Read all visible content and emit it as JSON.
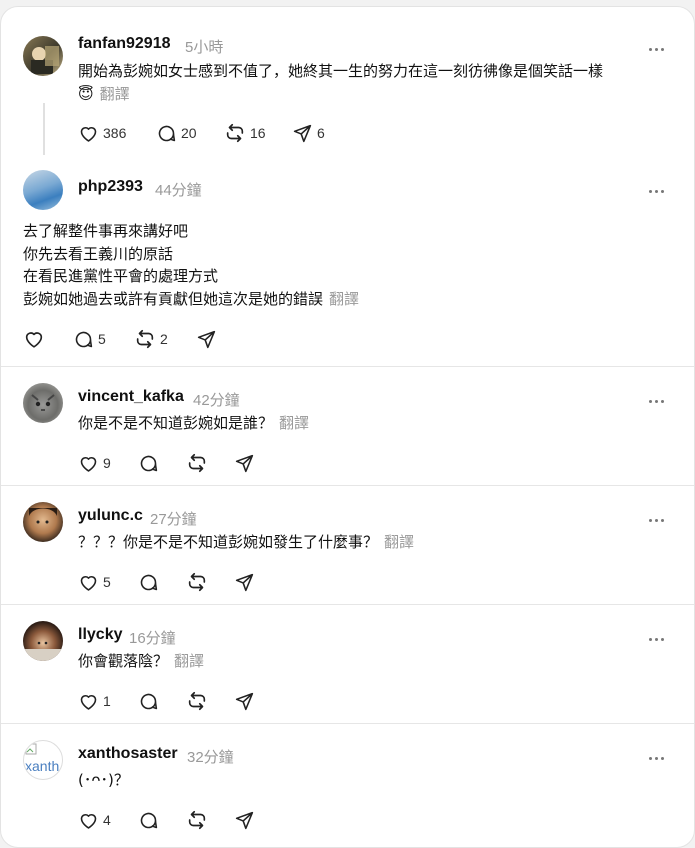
{
  "posts": [
    {
      "username": "fanfan92918",
      "time": "5小時",
      "lines": [
        "開始為彭婉如女士感到不值了，她終其一生的努力在這一刻彷彿像是個笑話一樣",
        "😇"
      ],
      "translate": "翻譯",
      "likes": "386",
      "comments": "20",
      "reposts": "16",
      "shares": "6"
    },
    {
      "username": "php2393",
      "time": "44分鐘",
      "lines": [
        "去了解整件事再來講好吧",
        "你先去看王義川的原話",
        "在看民進黨性平會的處理方式",
        "彭婉如她過去或許有貢獻但她這次是她的錯誤"
      ],
      "translate": "翻譯",
      "likes": "",
      "comments": "5",
      "reposts": "2",
      "shares": ""
    },
    {
      "username": "vincent_kafka",
      "time": "42分鐘",
      "lines": [
        "你是不是不知道彭婉如是誰？"
      ],
      "translate": "翻譯",
      "likes": "9",
      "comments": "",
      "reposts": "",
      "shares": ""
    },
    {
      "username": "yulunc.c",
      "time": "27分鐘",
      "lines": [
        "？？？你是不是不知道彭婉如發生了什麼事？"
      ],
      "translate": "翻譯",
      "likes": "5",
      "comments": "",
      "reposts": "",
      "shares": ""
    },
    {
      "username": "llycky",
      "time": "16分鐘",
      "lines": [
        "你會觀落陰？"
      ],
      "translate": "翻譯",
      "likes": "1",
      "comments": "",
      "reposts": "",
      "shares": ""
    },
    {
      "username": "xanthosaster",
      "time": "32分鐘",
      "lines": [
        "(･ᴖ･)？"
      ],
      "translate": "",
      "likes": "4",
      "comments": "",
      "reposts": "",
      "shares": "",
      "avatar_alt": "xanth"
    }
  ]
}
